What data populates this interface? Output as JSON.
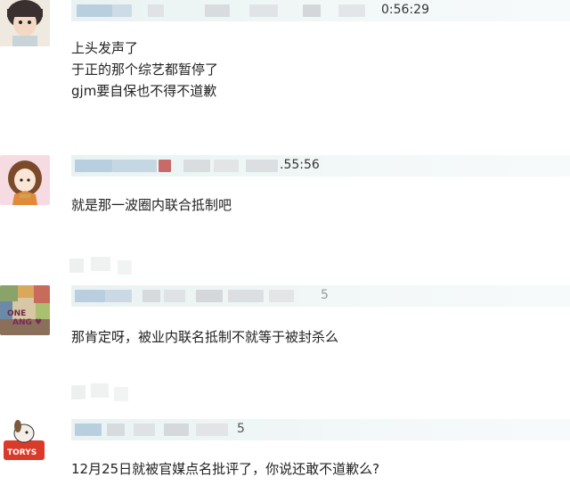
{
  "comments": [
    {
      "time": "0:56:29",
      "lines": [
        "上头发声了",
        "于正的那个综艺都暂停了",
        "gjm要自保也不得不道歉"
      ],
      "avatar": "girl-portrait-avatar"
    },
    {
      "time": ".55:56",
      "lines": [
        "就是那一波圈内联合抵制吧"
      ],
      "avatar": "cartoon-girl-avatar"
    },
    {
      "time": "5",
      "lines": [
        "那肯定呀，被业内联名抵制不就等于被封杀么"
      ],
      "avatar": "colorful-art-avatar"
    },
    {
      "time": "5",
      "lines": [
        "12月25日就被官媒点名批评了，你说还敢不道歉么?"
      ],
      "avatar": "torys-dog-avatar"
    }
  ],
  "colors": {
    "header_bg": "#eef5f5",
    "blur_blue": "#b8cfe0",
    "blur_gray": "#d6d9dc",
    "blur_red": "#c96a6a"
  }
}
